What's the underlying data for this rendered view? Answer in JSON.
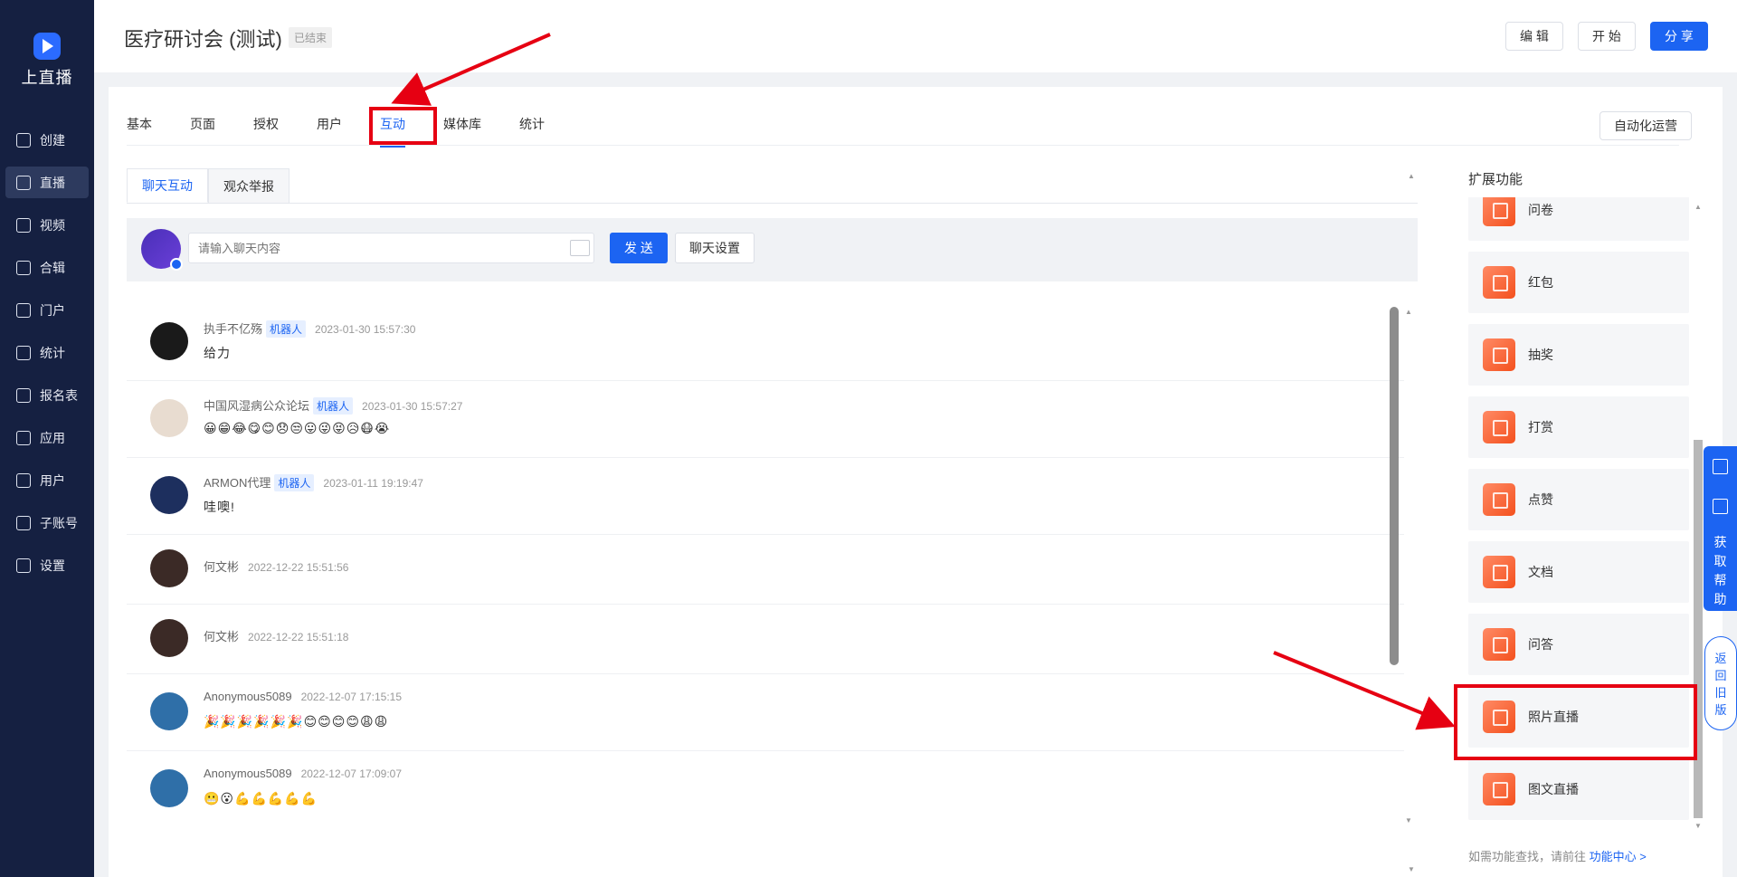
{
  "sidebar": {
    "logo_text": "上直播",
    "items": [
      {
        "label": "创建",
        "icon": "plus-square-icon"
      },
      {
        "label": "直播",
        "icon": "video-icon"
      },
      {
        "label": "视频",
        "icon": "film-icon"
      },
      {
        "label": "合辑",
        "icon": "collection-icon"
      },
      {
        "label": "门户",
        "icon": "monitor-icon"
      },
      {
        "label": "统计",
        "icon": "pie-chart-icon"
      },
      {
        "label": "报名表",
        "icon": "form-icon"
      },
      {
        "label": "应用",
        "icon": "apps-grid-icon"
      },
      {
        "label": "用户",
        "icon": "users-icon"
      },
      {
        "label": "子账号",
        "icon": "sub-account-icon"
      },
      {
        "label": "设置",
        "icon": "gear-icon"
      }
    ],
    "active": "直播"
  },
  "header": {
    "title": "医疗研讨会 (测试)",
    "status": "已结束",
    "edit_label": "编 辑",
    "start_label": "开 始",
    "share_label": "分 享"
  },
  "tabs": {
    "items": [
      "基本",
      "页面",
      "授权",
      "用户",
      "互动",
      "媒体库",
      "统计"
    ],
    "active": "互动",
    "auto_ops_label": "自动化运营"
  },
  "subtabs": {
    "items": [
      "聊天互动",
      "观众举报"
    ],
    "active": "聊天互动"
  },
  "composer": {
    "placeholder": "请输入聊天内容",
    "send_label": "发 送",
    "settings_label": "聊天设置"
  },
  "messages": [
    {
      "name": "执手不亿殇",
      "robot": "机器人",
      "time": "2023-01-30 15:57:30",
      "text": "给力"
    },
    {
      "name": "中国风湿病公众论坛",
      "robot": "机器人",
      "time": "2023-01-30 15:57:27",
      "text": "😀😁😂😋😊😞😒😛😜😝😥😷😭"
    },
    {
      "name": "ARMON代理",
      "robot": "机器人",
      "time": "2023-01-11 19:19:47",
      "text": "哇噢!"
    },
    {
      "name": "何文彬",
      "robot": "",
      "time": "2022-12-22 15:51:56",
      "text": ""
    },
    {
      "name": "何文彬",
      "robot": "",
      "time": "2022-12-22 15:51:18",
      "text": ""
    },
    {
      "name": "Anonymous5089",
      "robot": "",
      "time": "2022-12-07 17:15:15",
      "text": "🎉🎉🎉🎉🎉🎉😊😊😊😊😩😩"
    },
    {
      "name": "Anonymous5089",
      "robot": "",
      "time": "2022-12-07 17:09:07",
      "text": "😬😮💪💪💪💪💪"
    }
  ],
  "extensions": {
    "title": "扩展功能",
    "items": [
      {
        "label": "问卷",
        "icon": "questionnaire-icon"
      },
      {
        "label": "红包",
        "icon": "red-packet-icon"
      },
      {
        "label": "抽奖",
        "icon": "lottery-icon"
      },
      {
        "label": "打赏",
        "icon": "reward-icon"
      },
      {
        "label": "点赞",
        "icon": "thumbs-up-icon"
      },
      {
        "label": "文档",
        "icon": "document-icon"
      },
      {
        "label": "问答",
        "icon": "qa-icon"
      },
      {
        "label": "照片直播",
        "icon": "camera-icon"
      },
      {
        "label": "图文直播",
        "icon": "image-text-icon"
      }
    ],
    "footer_text": "如需功能查找，请前往",
    "footer_link": "功能中心 >"
  },
  "float_tools": {
    "help_label": "获取帮助",
    "old_version_label": "返回旧版"
  },
  "colors": {
    "primary": "#1c64f2",
    "sidebar_bg": "#152041",
    "highlight": "#e60012",
    "ext_icon": "#f4511e"
  }
}
